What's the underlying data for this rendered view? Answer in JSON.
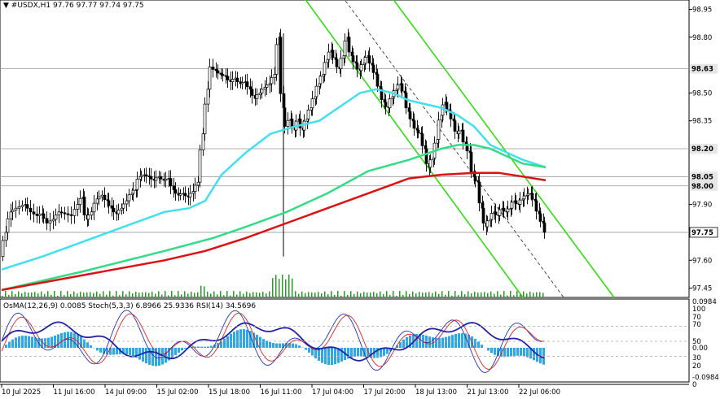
{
  "symbol_header": {
    "arrow": "▼",
    "symbol": "#USDX,H1",
    "ohlc": "97.76 97.77 97.74 97.75"
  },
  "indicator_header": "OsMA(12,26,9) 0.0085  Stoch(5,3,3) 6.8966 25.9336  RSI(14) 34.5696",
  "colors": {
    "candles": "#000000",
    "ma_fast": "#40e0f0",
    "ma_mid": "#33dd88",
    "ma_slow": "#dd1111",
    "channel": "#33dd11",
    "osma_hist": "#2aa8e8",
    "stoch_main": "#2233bb",
    "stoch_signal": "#dd2222",
    "rsi": "#2222aa",
    "price_tag_bg": "#e6e6e6",
    "current_price_bg": "#ffffff"
  },
  "chart_data": {
    "type": "candlestick",
    "timeframe": "H1",
    "price_axis_ticks": [
      "98.95",
      "98.80",
      "98.50",
      "98.35",
      "97.90",
      "97.60",
      "97.45"
    ],
    "price_levels": [
      "98.63",
      "98.20",
      "98.05",
      "98.00",
      "97.75"
    ],
    "current_price": "97.75",
    "ylim": [
      97.4,
      99.0
    ],
    "time_labels": [
      "10 Jul 2025",
      "11 Jul 16:00",
      "14 Jul 09:00",
      "15 Jul 02:00",
      "15 Jul 18:00",
      "16 Jul 11:00",
      "17 Jul 04:00",
      "17 Jul 20:00",
      "18 Jul 13:00",
      "21 Jul 13:00",
      "22 Jul 06:00"
    ],
    "close_path": [
      [
        0,
        97.62
      ],
      [
        6,
        97.75
      ],
      [
        12,
        97.86
      ],
      [
        20,
        97.88
      ],
      [
        30,
        97.9
      ],
      [
        38,
        97.86
      ],
      [
        45,
        97.84
      ],
      [
        50,
        97.85
      ],
      [
        58,
        97.8
      ],
      [
        65,
        97.82
      ],
      [
        72,
        97.86
      ],
      [
        80,
        97.85
      ],
      [
        88,
        97.84
      ],
      [
        95,
        97.9
      ],
      [
        100,
        97.94
      ],
      [
        105,
        97.82
      ],
      [
        112,
        97.86
      ],
      [
        118,
        97.93
      ],
      [
        125,
        97.95
      ],
      [
        130,
        97.92
      ],
      [
        136,
        97.88
      ],
      [
        142,
        97.85
      ],
      [
        148,
        97.88
      ],
      [
        155,
        97.92
      ],
      [
        160,
        97.96
      ],
      [
        165,
        97.98
      ],
      [
        170,
        98.05
      ],
      [
        176,
        98.06
      ],
      [
        182,
        98.05
      ],
      [
        188,
        98.03
      ],
      [
        194,
        98.05
      ],
      [
        200,
        98.03
      ],
      [
        206,
        98.04
      ],
      [
        212,
        97.98
      ],
      [
        218,
        97.95
      ],
      [
        224,
        97.96
      ],
      [
        230,
        97.94
      ],
      [
        236,
        97.97
      ],
      [
        242,
        98.02
      ],
      [
        248,
        98.28
      ],
      [
        254,
        98.52
      ],
      [
        258,
        98.64
      ],
      [
        264,
        98.62
      ],
      [
        270,
        98.6
      ],
      [
        276,
        98.59
      ],
      [
        282,
        98.56
      ],
      [
        288,
        98.58
      ],
      [
        294,
        98.55
      ],
      [
        300,
        98.56
      ],
      [
        306,
        98.52
      ],
      [
        312,
        98.47
      ],
      [
        318,
        98.5
      ],
      [
        324,
        98.53
      ],
      [
        330,
        98.55
      ],
      [
        336,
        98.6
      ],
      [
        341,
        98.8
      ],
      [
        346,
        98.42
      ],
      [
        350,
        98.32
      ],
      [
        355,
        98.36
      ],
      [
        360,
        98.3
      ],
      [
        365,
        98.36
      ],
      [
        370,
        98.3
      ],
      [
        375,
        98.36
      ],
      [
        380,
        98.42
      ],
      [
        385,
        98.48
      ],
      [
        390,
        98.55
      ],
      [
        395,
        98.6
      ],
      [
        400,
        98.68
      ],
      [
        405,
        98.73
      ],
      [
        410,
        98.68
      ],
      [
        415,
        98.63
      ],
      [
        420,
        98.7
      ],
      [
        425,
        98.8
      ],
      [
        430,
        98.7
      ],
      [
        435,
        98.66
      ],
      [
        440,
        98.62
      ],
      [
        445,
        98.66
      ],
      [
        450,
        98.7
      ],
      [
        455,
        98.65
      ],
      [
        460,
        98.6
      ],
      [
        465,
        98.52
      ],
      [
        470,
        98.45
      ],
      [
        475,
        98.42
      ],
      [
        480,
        98.48
      ],
      [
        485,
        98.52
      ],
      [
        490,
        98.55
      ],
      [
        495,
        98.5
      ],
      [
        500,
        98.4
      ],
      [
        505,
        98.35
      ],
      [
        510,
        98.3
      ],
      [
        515,
        98.28
      ],
      [
        520,
        98.2
      ],
      [
        525,
        98.1
      ],
      [
        530,
        98.15
      ],
      [
        535,
        98.25
      ],
      [
        540,
        98.38
      ],
      [
        545,
        98.45
      ],
      [
        550,
        98.4
      ],
      [
        555,
        98.35
      ],
      [
        560,
        98.28
      ],
      [
        565,
        98.3
      ],
      [
        570,
        98.22
      ],
      [
        575,
        98.18
      ],
      [
        580,
        98.05
      ],
      [
        585,
        98.02
      ],
      [
        590,
        97.88
      ],
      [
        595,
        97.78
      ],
      [
        600,
        97.82
      ],
      [
        605,
        97.86
      ],
      [
        610,
        97.84
      ],
      [
        615,
        97.88
      ],
      [
        620,
        97.86
      ],
      [
        625,
        97.88
      ],
      [
        630,
        97.92
      ],
      [
        635,
        97.9
      ],
      [
        640,
        97.93
      ],
      [
        645,
        97.95
      ],
      [
        650,
        97.96
      ],
      [
        655,
        97.92
      ],
      [
        660,
        97.85
      ],
      [
        665,
        97.8
      ],
      [
        668,
        97.75
      ]
    ],
    "ma_fast_path": [
      [
        0,
        97.55
      ],
      [
        50,
        97.62
      ],
      [
        100,
        97.7
      ],
      [
        150,
        97.78
      ],
      [
        200,
        97.86
      ],
      [
        230,
        97.88
      ],
      [
        250,
        97.92
      ],
      [
        270,
        98.06
      ],
      [
        300,
        98.18
      ],
      [
        330,
        98.28
      ],
      [
        360,
        98.32
      ],
      [
        390,
        98.35
      ],
      [
        420,
        98.44
      ],
      [
        440,
        98.5
      ],
      [
        460,
        98.52
      ],
      [
        480,
        98.5
      ],
      [
        500,
        98.46
      ],
      [
        520,
        98.44
      ],
      [
        540,
        98.42
      ],
      [
        560,
        98.38
      ],
      [
        580,
        98.32
      ],
      [
        600,
        98.22
      ],
      [
        620,
        98.18
      ],
      [
        640,
        98.14
      ],
      [
        668,
        98.1
      ]
    ],
    "ma_mid_path": [
      [
        0,
        97.44
      ],
      [
        100,
        97.54
      ],
      [
        200,
        97.65
      ],
      [
        260,
        97.72
      ],
      [
        300,
        97.78
      ],
      [
        350,
        97.86
      ],
      [
        400,
        97.96
      ],
      [
        450,
        98.08
      ],
      [
        500,
        98.14
      ],
      [
        540,
        98.2
      ],
      [
        560,
        98.22
      ],
      [
        580,
        98.22
      ],
      [
        600,
        98.2
      ],
      [
        620,
        98.16
      ],
      [
        640,
        98.12
      ],
      [
        668,
        98.1
      ]
    ],
    "ma_slow_path": [
      [
        0,
        97.44
      ],
      [
        100,
        97.52
      ],
      [
        200,
        97.6
      ],
      [
        250,
        97.65
      ],
      [
        300,
        97.72
      ],
      [
        350,
        97.8
      ],
      [
        400,
        97.88
      ],
      [
        450,
        97.96
      ],
      [
        500,
        98.04
      ],
      [
        540,
        98.06
      ],
      [
        580,
        98.07
      ],
      [
        610,
        98.07
      ],
      [
        640,
        98.05
      ],
      [
        668,
        98.03
      ]
    ],
    "channel_lines": [
      [
        [
          370,
          99.02
        ],
        [
          640,
          97.4
        ]
      ],
      [
        [
          478,
          99.02
        ],
        [
          752,
          97.4
        ]
      ],
      [
        [
          418,
          99.02
        ],
        [
          690,
          97.4
        ]
      ]
    ],
    "osma_scale": [
      "0.0984",
      "0.00",
      "-0.0984"
    ],
    "osc_scale": [
      "100",
      "70",
      "50",
      "30",
      "20",
      "0"
    ]
  }
}
